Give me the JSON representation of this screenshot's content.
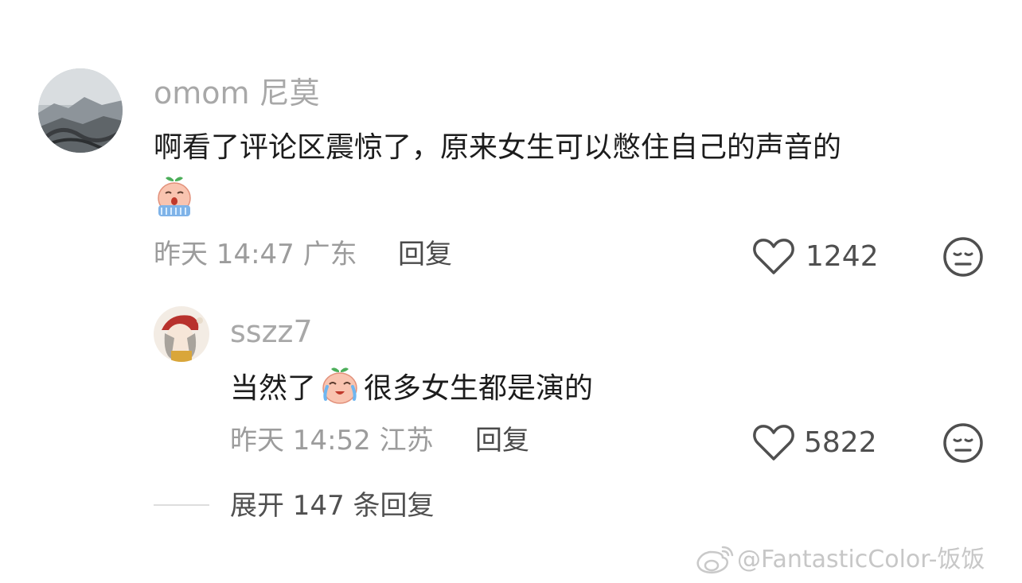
{
  "comment": {
    "username": "omom 尼莫",
    "text": "啊看了评论区震惊了，原来女生可以憋住自己的声音的",
    "emoji": "crying-emoji",
    "meta": "昨天 14:47 广东",
    "reply_label": "回复",
    "likes": "1242"
  },
  "reply": {
    "username": "sszz7",
    "text_before": "当然了",
    "emoji": "crying-emoji",
    "text_after": "很多女生都是演的",
    "meta": "昨天 14:52 江苏",
    "reply_label": "回复",
    "likes": "5822"
  },
  "expand_label": "展开 147 条回复",
  "watermark": "@FantasticColor-饭饭",
  "icons": {
    "like": "heart-outline-icon",
    "dislike": "meh-face-icon",
    "watermark_logo": "weibo-logo"
  }
}
